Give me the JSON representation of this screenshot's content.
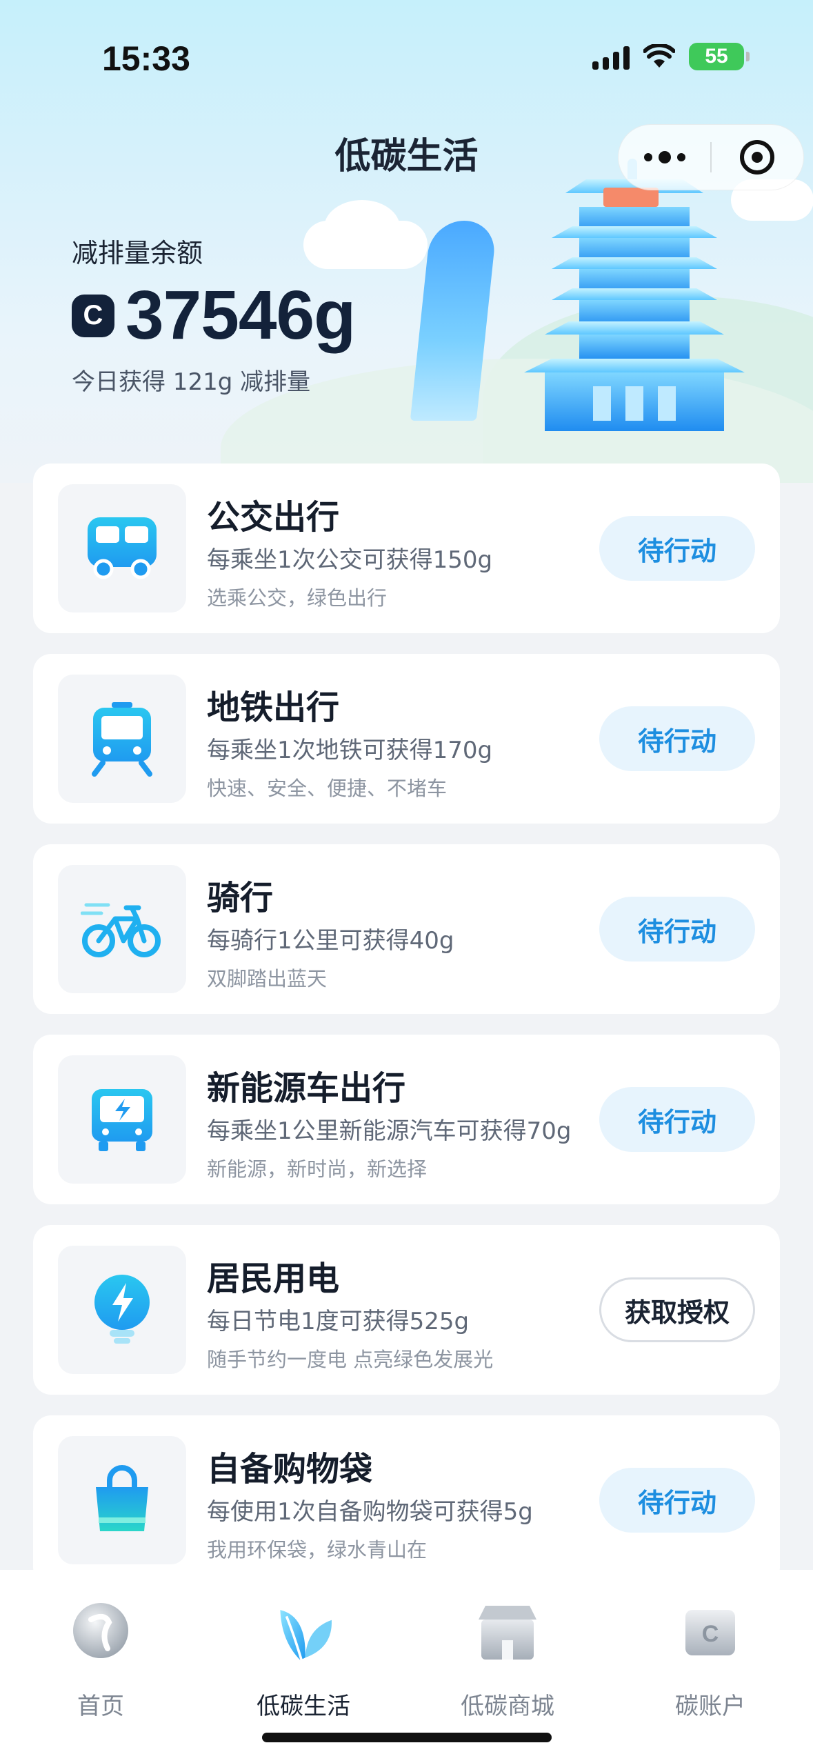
{
  "status_bar": {
    "time": "15:33",
    "battery": "55"
  },
  "header": {
    "title": "低碳生活"
  },
  "balance": {
    "label": "减排量余额",
    "coin_glyph": "C",
    "value": "37546g",
    "today": "今日获得 121g 减排量"
  },
  "activities": [
    {
      "title": "公交出行",
      "desc": "每乘坐1次公交可获得150g",
      "sub": "选乘公交，绿色出行",
      "action": "待行动",
      "icon": "bus-icon"
    },
    {
      "title": "地铁出行",
      "desc": "每乘坐1次地铁可获得170g",
      "sub": "快速、安全、便捷、不堵车",
      "action": "待行动",
      "icon": "subway-icon"
    },
    {
      "title": "骑行",
      "desc": "每骑行1公里可获得40g",
      "sub": "双脚踏出蓝天",
      "action": "待行动",
      "icon": "bicycle-icon"
    },
    {
      "title": "新能源车出行",
      "desc": "每乘坐1公里新能源汽车可获得70g",
      "sub": "新能源，新时尚，新选择",
      "action": "待行动",
      "icon": "electric-car-icon"
    },
    {
      "title": "居民用电",
      "desc": "每日节电1度可获得525g",
      "sub": "随手节约一度电 点亮绿色发展光",
      "action": "获取授权",
      "icon": "lightbulb-icon"
    },
    {
      "title": "自备购物袋",
      "desc": "每使用1次自备购物袋可获得5g",
      "sub": "我用环保袋，绿水青山在",
      "action": "待行动",
      "icon": "shopping-bag-icon"
    }
  ],
  "tabbar": {
    "tabs": [
      {
        "label": "首页",
        "icon": "home-icon"
      },
      {
        "label": "低碳生活",
        "icon": "leaf-icon"
      },
      {
        "label": "低碳商城",
        "icon": "store-icon"
      },
      {
        "label": "碳账户",
        "icon": "wallet-icon"
      }
    ],
    "active": "低碳生活"
  },
  "colors": {
    "accent": "#1d8ee0",
    "icon_gradient_start": "#2ac7f0",
    "icon_gradient_end": "#1f9bf0",
    "text_primary": "#151d2b"
  }
}
